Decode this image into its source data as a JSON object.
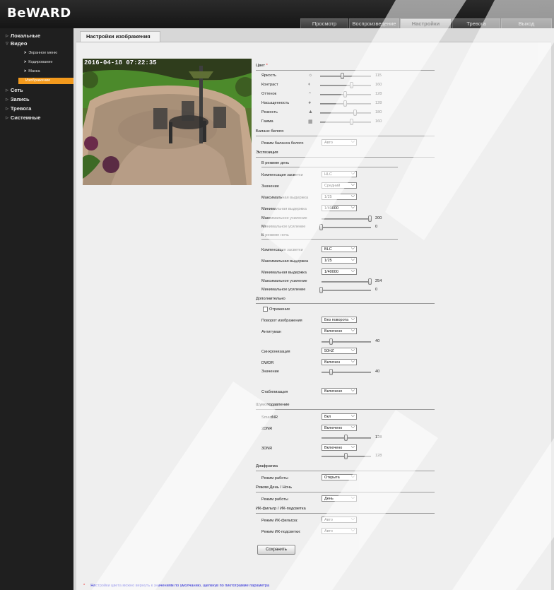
{
  "header": {
    "logo": "BeWARD",
    "tabs": [
      {
        "label": "Просмотр",
        "active": false
      },
      {
        "label": "Воспроизведение",
        "active": false
      },
      {
        "label": "Настройки",
        "active": true
      },
      {
        "label": "Тревога",
        "active": false
      },
      {
        "label": "Выход",
        "active": false
      }
    ]
  },
  "sidebar": {
    "items": [
      {
        "label": "Локальные"
      },
      {
        "label": "Видео"
      },
      {
        "label": "Сеть"
      },
      {
        "label": "Запись"
      },
      {
        "label": "Тревога"
      },
      {
        "label": "Системные"
      }
    ],
    "video_sub": [
      {
        "label": "Экранное меню"
      },
      {
        "label": "Кодирование"
      },
      {
        "label": "Маска"
      },
      {
        "label": "Изображение",
        "active": true
      }
    ]
  },
  "page": {
    "tab_title": "Настройки изображения",
    "camera_osd": "2016-04-18 07:22:35"
  },
  "color": {
    "title": "Цвет",
    "asterisk": "*",
    "sliders": [
      {
        "label": "Яркость",
        "icon": "brightness-icon",
        "value": "115",
        "level": 0.45
      },
      {
        "label": "Контраст",
        "icon": "contrast-icon",
        "value": "160",
        "level": 0.63
      },
      {
        "label": "Оттенок",
        "icon": "hue-icon",
        "value": "128",
        "level": 0.5
      },
      {
        "label": "Насыщенность",
        "icon": "saturation-icon",
        "value": "128",
        "level": 0.5
      },
      {
        "label": "Резкость",
        "icon": "sharpness-icon",
        "value": "180",
        "level": 0.7
      },
      {
        "label": "Гамма",
        "icon": "gamma-icon",
        "value": "160",
        "level": 0.63
      }
    ]
  },
  "white_balance": {
    "title": "Баланс белого",
    "mode_label": "Режим баланса белого",
    "mode_value": "Авто"
  },
  "exposure": {
    "title": "Экспозиция",
    "day": {
      "title": "В режиме день",
      "backlight_label": "Компенсация засветки",
      "backlight_value": "HLC",
      "value_label": "Значение",
      "value_value": "Средний",
      "max_shutter_label": "Максимальная выдержка",
      "max_shutter_value": "1/25",
      "min_shutter_label": "Минимальная выдержка",
      "min_shutter_value": "1/40000",
      "max_gain_label": "Максимальное усиление",
      "max_gain_value": "200",
      "max_gain_level": 0.99,
      "min_gain_label": "Минимальное усиление",
      "min_gain_value": "0",
      "min_gain_level": 0
    },
    "night": {
      "title": "В режиме ночь",
      "backlight_label": "Компенсация засветки",
      "backlight_value": "BLC",
      "max_shutter_label": "Максимальная выдержка",
      "max_shutter_value": "1/25",
      "min_shutter_label": "Минимальная выдержка",
      "min_shutter_value": "1/40000",
      "max_gain_label": "Максимальное усиление",
      "max_gain_value": "254",
      "max_gain_level": 0.99,
      "min_gain_label": "Минимальное усиление",
      "min_gain_value": "0",
      "min_gain_level": 0
    }
  },
  "additional": {
    "title": "Дополнительно",
    "mirror_label": "Отражение",
    "rotate_label": "Поворот изображения",
    "rotate_value": "Без поворота",
    "antifog_label": "Антитуман",
    "antifog_value": "Включено",
    "antifog_level_value": "40",
    "antifog_level": 0.2,
    "sync_label": "Синхронизация",
    "sync_value": "50HZ",
    "dwdr_label": "DWDR",
    "dwdr_value": "Включен",
    "dwdr_level_label": "Значение",
    "dwdr_level_value": "40",
    "dwdr_level": 0.2,
    "stab_label": "Стабилизация",
    "stab_value": "Включено"
  },
  "noise": {
    "title": "Шумоподавление",
    "smartnr_label": "SmartNR",
    "smartnr_value": "Вкл",
    "nr2d_label": "2DNR",
    "nr2d_value": "Включено",
    "nr2d_level_value": "128",
    "nr2d_level": 0.5,
    "nr3d_label": "3DNR",
    "nr3d_value": "Включено",
    "nr3d_level_value": "128",
    "nr3d_level": 0.5
  },
  "iris": {
    "title": "Диафрагма",
    "mode_label": "Режим работы",
    "mode_value": "Открыта"
  },
  "daynight": {
    "title": "Режим День / Ночь",
    "mode_label": "Режим работы",
    "mode_value": "День"
  },
  "ir": {
    "title": "ИК-фильтр / ИК-подсветка",
    "filter_label": "Режим ИК-фильтра:",
    "filter_value": "Авто",
    "light_label": "Режим ИК-подсветки:",
    "light_value": "Авто"
  },
  "save_label": "Сохранить",
  "footnote": {
    "asterisk": "*",
    "text": "Настройки цвета можно вернуть к значениям по умолчанию, щелкнув по пиктограмме параметра"
  }
}
